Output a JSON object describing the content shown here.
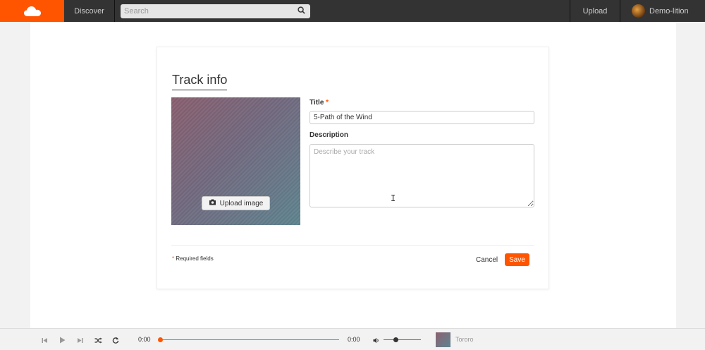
{
  "header": {
    "discover_label": "Discover",
    "search_placeholder": "Search",
    "upload_label": "Upload",
    "username": "Demo-lition"
  },
  "form": {
    "heading": "Track info",
    "upload_image_label": "Upload image",
    "title_label": "Title",
    "required_marker": "*",
    "title_value": "5-Path of the Wind",
    "description_label": "Description",
    "description_placeholder": "Describe your track",
    "required_note": "Required fields",
    "cancel_label": "Cancel",
    "save_label": "Save"
  },
  "player": {
    "elapsed": "0:00",
    "duration": "0:00",
    "track_title": "Tororo",
    "progress": 0,
    "volume": 0.35
  },
  "colors": {
    "accent": "#ff5500",
    "topbar": "#333333"
  },
  "icons": [
    "soundcloud-logo-icon",
    "search-icon",
    "camera-icon",
    "skip-back-icon",
    "play-icon",
    "skip-forward-icon",
    "shuffle-icon",
    "repeat-icon",
    "volume-icon"
  ]
}
